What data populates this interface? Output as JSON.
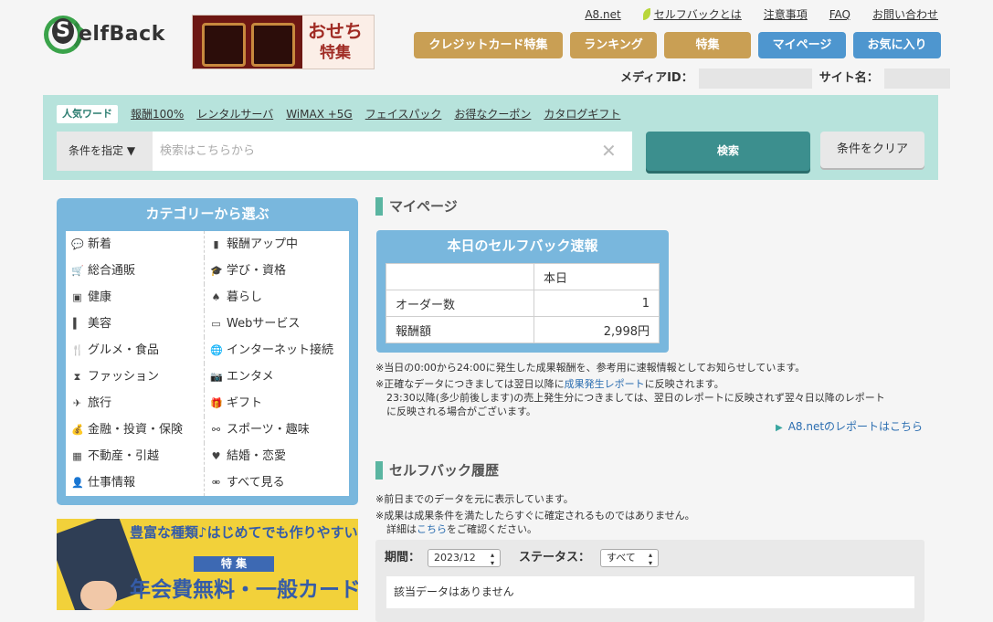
{
  "logo": {
    "text": "elfBack",
    "letter": "S"
  },
  "banner_top": {
    "line1": "おせち",
    "line2": "特集"
  },
  "top_links": [
    "A8.net",
    "セルフバックとは",
    "注意事項",
    "FAQ",
    "お問い合わせ"
  ],
  "nav": {
    "credit": "クレジットカード特集",
    "ranking": "ランキング",
    "special": "特集",
    "mypage": "マイページ",
    "favorites": "お気に入り"
  },
  "media": {
    "id_label": "メディアID：",
    "site_label": "サイト名："
  },
  "search": {
    "popular_tag": "人気ワード",
    "keywords": [
      "報酬100%",
      "レンタルサーバ",
      "WiMAX +5G",
      "フェイスパック",
      "お得なクーポン",
      "カタログギフト"
    ],
    "condition_label": "条件を指定 ▼",
    "placeholder": "検索はこちらから",
    "search_button": "検索",
    "clear_button": "条件をクリア"
  },
  "categories": {
    "title": "カテゴリーから選ぶ",
    "items": [
      {
        "label": "新着",
        "icon": "speech-bubble-icon"
      },
      {
        "label": "報酬アップ中",
        "icon": "bar-chart-icon"
      },
      {
        "label": "総合通販",
        "icon": "cart-icon"
      },
      {
        "label": "学び・資格",
        "icon": "graduation-cap-icon"
      },
      {
        "label": "健康",
        "icon": "bottle-icon"
      },
      {
        "label": "暮らし",
        "icon": "tree-icon"
      },
      {
        "label": "美容",
        "icon": "lipstick-icon"
      },
      {
        "label": "Webサービス",
        "icon": "monitor-icon"
      },
      {
        "label": "グルメ・食品",
        "icon": "fork-knife-icon"
      },
      {
        "label": "インターネット接続",
        "icon": "globe-icon"
      },
      {
        "label": "ファッション",
        "icon": "dress-icon"
      },
      {
        "label": "エンタメ",
        "icon": "camera-icon"
      },
      {
        "label": "旅行",
        "icon": "airplane-icon"
      },
      {
        "label": "ギフト",
        "icon": "gift-icon"
      },
      {
        "label": "金融・投資・保険",
        "icon": "money-bag-icon"
      },
      {
        "label": "スポーツ・趣味",
        "icon": "dumbbell-icon"
      },
      {
        "label": "不動産・引越",
        "icon": "store-icon"
      },
      {
        "label": "結婚・恋愛",
        "icon": "heart-icon"
      },
      {
        "label": "仕事情報",
        "icon": "person-icon"
      },
      {
        "label": "すべて見る",
        "icon": "binoculars-icon"
      }
    ]
  },
  "card_banner": {
    "line1": "豊富な種類♪はじめてでも作りやすい",
    "tag": "特 集",
    "line2": "年会費無料・一般カード"
  },
  "mypage": {
    "title": "マイページ",
    "flash_title": "本日のセルフバック速報",
    "table": {
      "header": "本日",
      "rows": [
        {
          "label": "オーダー数",
          "value": "1"
        },
        {
          "label": "報酬額",
          "value": "2,998円"
        }
      ]
    },
    "note1": "※当日の0:00から24:00に発生した成果報酬を、参考用に速報情報としてお知らせしています。",
    "note2_pre": "※正確なデータにつきましては翌日以降に",
    "note2_link": "成果発生レポート",
    "note2_post": "に反映されます。",
    "note3": "23:30以降(多少前後します)の売上発生分につきましては、翌日のレポートに反映されず翌々日以降のレポート",
    "note4": "に反映される場合がございます。",
    "report_link": "A8.netのレポートはこちら"
  },
  "history": {
    "title": "セルフバック履歴",
    "note1": "※前日までのデータを元に表示しています。",
    "note2": "※成果は成果条件を満たしたらすぐに確定されるものではありません。",
    "note3_pre": "詳細は",
    "note3_link": "こちら",
    "note3_post": "をご確認ください。",
    "period_label": "期間：",
    "period_value": "2023/12",
    "status_label": "ステータス：",
    "status_value": "すべて",
    "empty": "該当データはありません"
  }
}
